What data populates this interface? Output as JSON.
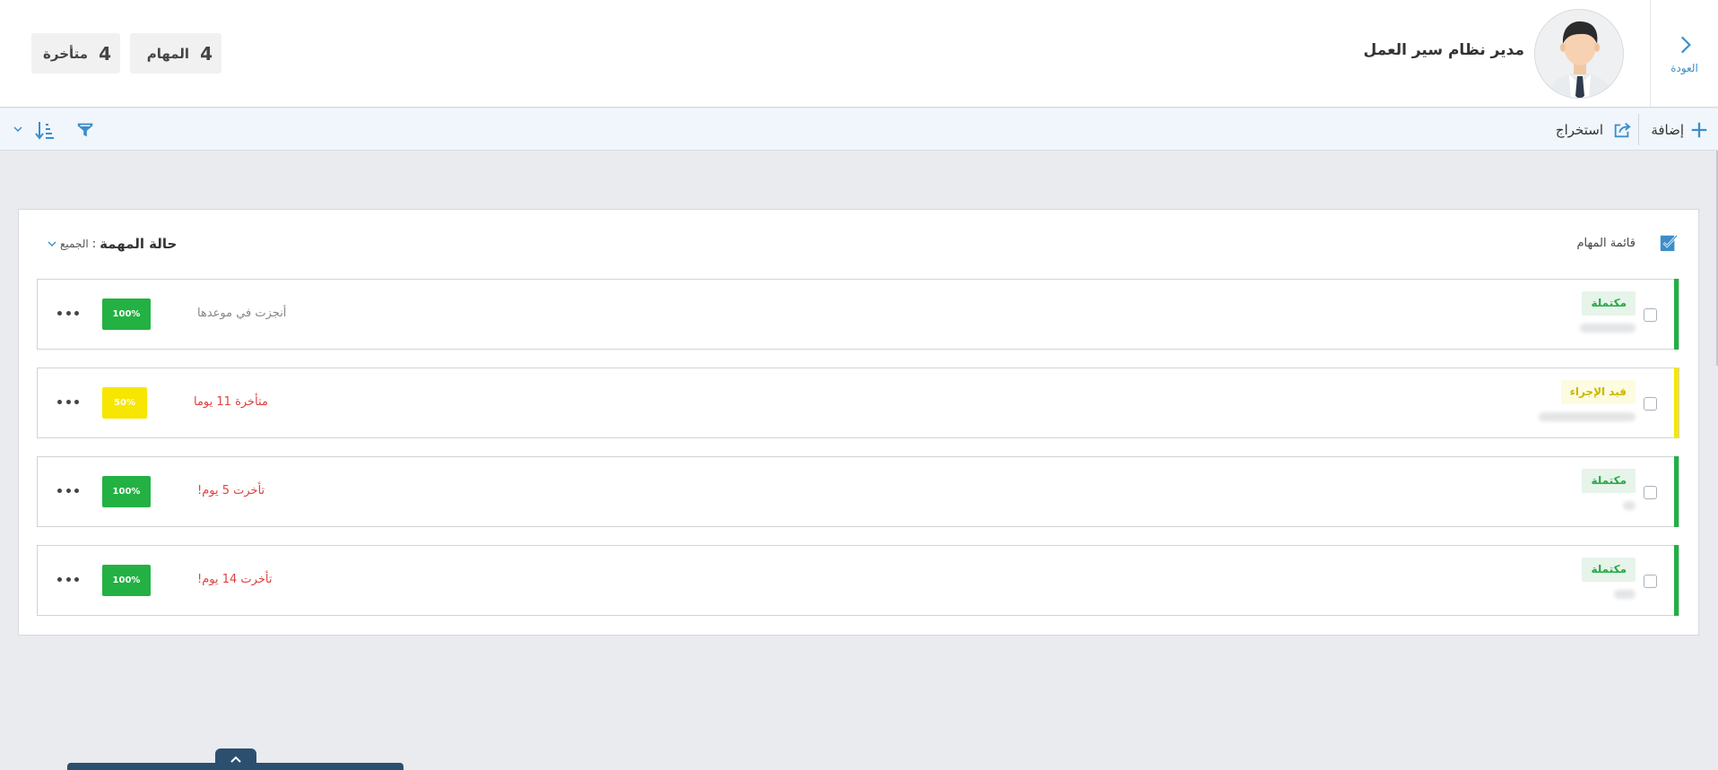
{
  "header": {
    "back_label": "العودة",
    "user_title": "مدير نظام سير العمل",
    "stats": {
      "tasks_count": "4",
      "tasks_label": "المهام",
      "late_count": "4",
      "late_label": "متأخرة"
    }
  },
  "toolbar": {
    "add_label": "إضافة",
    "export_label": "استخراج"
  },
  "panel": {
    "title": "قائمة المهام",
    "status_filter_label": "حالة المهمة",
    "status_filter_colon": ":",
    "status_filter_value": "الجميع"
  },
  "tasks": [
    {
      "status": "مكتملة",
      "status_kind": "done",
      "bar_color": "#1fb141",
      "message": "أنجزت في موعدها",
      "message_kind": "gray",
      "progress_label": "100%",
      "progress": 1.0,
      "progress_color": "#23b143"
    },
    {
      "status": "قيد الإجراء",
      "status_kind": "prog",
      "bar_color": "#f6e600",
      "message": "متأخرة 11 يوما",
      "message_kind": "red",
      "progress_label": "50%",
      "progress": 0.5,
      "progress_color": "#f6e600"
    },
    {
      "status": "مكتملة",
      "status_kind": "done",
      "bar_color": "#1fb141",
      "message": "تأخرت 5 يوم!",
      "message_kind": "red",
      "progress_label": "100%",
      "progress": 1.0,
      "progress_color": "#23b143"
    },
    {
      "status": "مكتملة",
      "status_kind": "done",
      "bar_color": "#1fb141",
      "message": "تأخرت 14 يوم!",
      "message_kind": "red",
      "progress_label": "100%",
      "progress": 1.0,
      "progress_color": "#23b143"
    }
  ],
  "colors": {
    "accent": "#3b8ec9",
    "complete": "#23b143",
    "in_progress": "#f6e600",
    "late_text": "#e0403f"
  },
  "icons": {
    "back": "chevron-right-icon",
    "add": "plus-icon",
    "export": "export-icon",
    "filter": "filter-icon",
    "sort": "sort-icon",
    "task_list": "task-list-icon",
    "more": "more-dots-icon",
    "collapse": "chevron-up-icon"
  }
}
